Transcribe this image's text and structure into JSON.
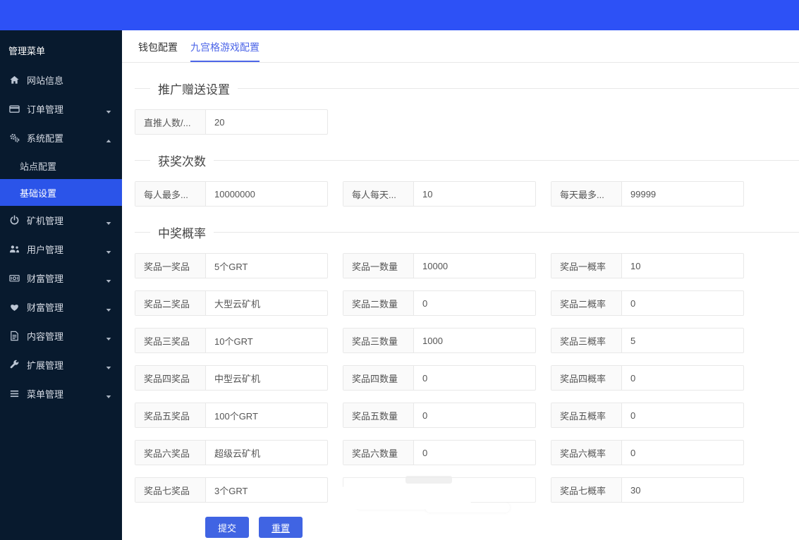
{
  "sidebar": {
    "title": "管理菜单",
    "items": [
      {
        "key": "website-info",
        "label": "网站信息",
        "icon": "home-icon",
        "caret": null
      },
      {
        "key": "order-management",
        "label": "订单管理",
        "icon": "credit-card-icon",
        "caret": "down"
      },
      {
        "key": "system-config",
        "label": "系统配置",
        "icon": "cogs-icon",
        "caret": "up",
        "children": [
          {
            "key": "site-config",
            "label": "站点配置",
            "active": false
          },
          {
            "key": "basic-settings",
            "label": "基础设置",
            "active": true
          }
        ]
      },
      {
        "key": "miner-management",
        "label": "矿机管理",
        "icon": "power-icon",
        "caret": "down"
      },
      {
        "key": "user-management",
        "label": "用户管理",
        "icon": "users-icon",
        "caret": "down"
      },
      {
        "key": "wealth-management-1",
        "label": "财富管理",
        "icon": "money-icon",
        "caret": "down"
      },
      {
        "key": "wealth-management-2",
        "label": "财富管理",
        "icon": "heart-icon",
        "caret": "down"
      },
      {
        "key": "content-management",
        "label": "内容管理",
        "icon": "file-icon",
        "caret": "down"
      },
      {
        "key": "extension-management",
        "label": "扩展管理",
        "icon": "wrench-icon",
        "caret": "down"
      },
      {
        "key": "menu-management",
        "label": "菜单管理",
        "icon": "bars-icon",
        "caret": "down"
      }
    ]
  },
  "tabs": [
    {
      "key": "wallet-config",
      "label": "钱包配置",
      "active": false
    },
    {
      "key": "grid-game-config",
      "label": "九宫格游戏配置",
      "active": true
    }
  ],
  "form": {
    "sections": [
      {
        "title": "推广赠送设置",
        "rows": [
          [
            {
              "label": "直推人数/...",
              "value": "20"
            }
          ]
        ]
      },
      {
        "title": "获奖次数",
        "rows": [
          [
            {
              "label": "每人最多...",
              "value": "10000000"
            },
            {
              "label": "每人每天...",
              "value": "10"
            },
            {
              "label": "每天最多...",
              "value": "99999"
            }
          ]
        ]
      },
      {
        "title": "中奖概率",
        "rows": [
          [
            {
              "label": "奖品一奖品",
              "value": "5个GRT"
            },
            {
              "label": "奖品一数量",
              "value": "10000"
            },
            {
              "label": "奖品一概率",
              "value": "10"
            }
          ],
          [
            {
              "label": "奖品二奖品",
              "value": "大型云矿机"
            },
            {
              "label": "奖品二数量",
              "value": "0"
            },
            {
              "label": "奖品二概率",
              "value": "0"
            }
          ],
          [
            {
              "label": "奖品三奖品",
              "value": "10个GRT"
            },
            {
              "label": "奖品三数量",
              "value": "1000"
            },
            {
              "label": "奖品三概率",
              "value": "5"
            }
          ],
          [
            {
              "label": "奖品四奖品",
              "value": "中型云矿机"
            },
            {
              "label": "奖品四数量",
              "value": "0"
            },
            {
              "label": "奖品四概率",
              "value": "0"
            }
          ],
          [
            {
              "label": "奖品五奖品",
              "value": "100个GRT"
            },
            {
              "label": "奖品五数量",
              "value": "0"
            },
            {
              "label": "奖品五概率",
              "value": "0"
            }
          ],
          [
            {
              "label": "奖品六奖品",
              "value": "超级云矿机"
            },
            {
              "label": "奖品六数量",
              "value": "0"
            },
            {
              "label": "奖品六概率",
              "value": "0"
            }
          ],
          [
            {
              "label": "奖品七奖品",
              "value": "3个GRT"
            },
            {
              "obscured": true
            },
            {
              "label": "奖品七概率",
              "value": "30"
            }
          ]
        ]
      }
    ],
    "buttons": {
      "submit": "提交",
      "reset": "重置"
    }
  },
  "colors": {
    "topbar": "#2d51f6",
    "sidebar_bg": "#081a2e",
    "active_item": "#2b54e9",
    "tab_accent": "#4d66e8",
    "button_blue": "#4064e3"
  }
}
